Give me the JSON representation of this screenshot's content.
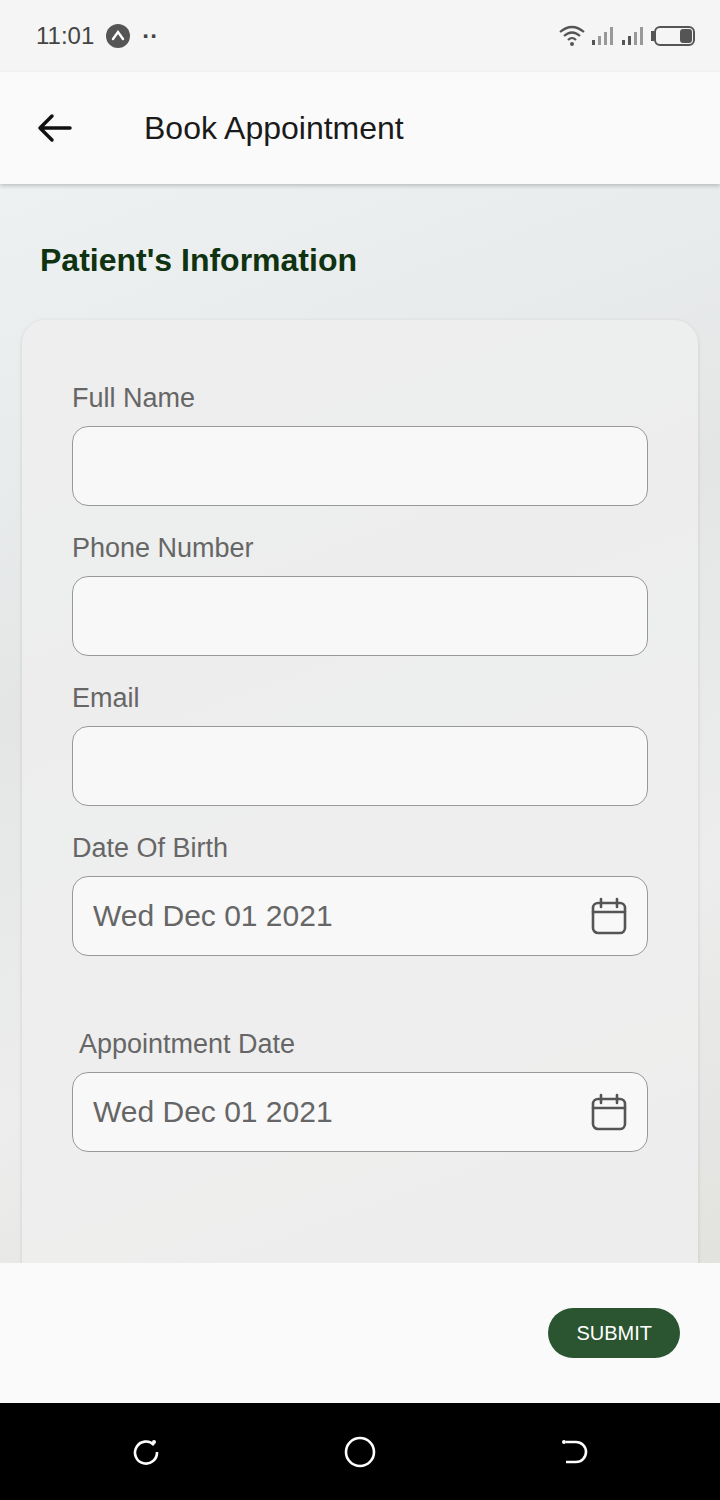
{
  "status_bar": {
    "time": "11:01",
    "dots": "··"
  },
  "app_bar": {
    "title": "Book Appointment"
  },
  "section": {
    "title": "Patient's Information"
  },
  "fields": [
    {
      "label": "Full Name",
      "value": "",
      "kind": "text"
    },
    {
      "label": "Phone Number",
      "value": "",
      "kind": "text"
    },
    {
      "label": "Email",
      "value": "",
      "kind": "text"
    },
    {
      "label": "Date Of Birth",
      "value": "Wed Dec 01 2021",
      "kind": "date"
    },
    {
      "label": "Appointment Date",
      "value": "Wed Dec 01 2021",
      "kind": "date"
    }
  ],
  "buttons": [
    "SUBMIT"
  ]
}
